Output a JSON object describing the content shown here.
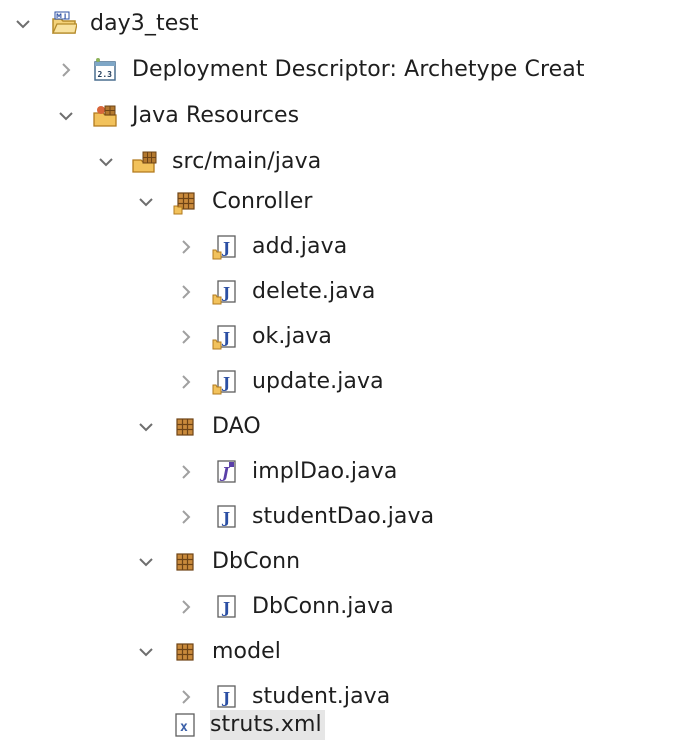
{
  "tree": {
    "project": {
      "label": "day3_test",
      "icon": "project-folder-icon",
      "expanded": true
    },
    "deployment": {
      "label": "Deployment Descriptor: Archetype Creat",
      "icon": "deployment-descriptor-icon",
      "expanded": false
    },
    "java_resources": {
      "label": "Java Resources",
      "icon": "java-resources-icon",
      "expanded": true
    },
    "src": {
      "label": "src/main/java",
      "icon": "source-folder-icon",
      "expanded": true
    },
    "packages": [
      {
        "label": "Conroller",
        "icon": "package-icon",
        "expanded": true,
        "files": [
          {
            "label": "add.java",
            "icon": "java-file-icon"
          },
          {
            "label": "delete.java",
            "icon": "java-file-icon"
          },
          {
            "label": "ok.java",
            "icon": "java-file-icon"
          },
          {
            "label": "update.java",
            "icon": "java-file-icon"
          }
        ]
      },
      {
        "label": "DAO",
        "icon": "package-icon",
        "expanded": true,
        "files": [
          {
            "label": "implDao.java",
            "icon": "java-interface-file-icon"
          },
          {
            "label": "studentDao.java",
            "icon": "java-file-icon"
          }
        ]
      },
      {
        "label": "DbConn",
        "icon": "package-icon",
        "expanded": true,
        "files": [
          {
            "label": "DbConn.java",
            "icon": "java-file-icon"
          }
        ]
      },
      {
        "label": "model",
        "icon": "package-icon",
        "expanded": true,
        "files": [
          {
            "label": "student.java",
            "icon": "java-file-icon"
          }
        ]
      }
    ],
    "struts": {
      "label": "struts.xml",
      "icon": "xml-file-icon",
      "selected": true
    }
  },
  "colors": {
    "chevron": "#8c8c8c",
    "package_brown": "#8a5a2b",
    "java_blue": "#2b4fa3",
    "folder_yellow": "#e9b84a",
    "selection": "#e6e6e6"
  }
}
